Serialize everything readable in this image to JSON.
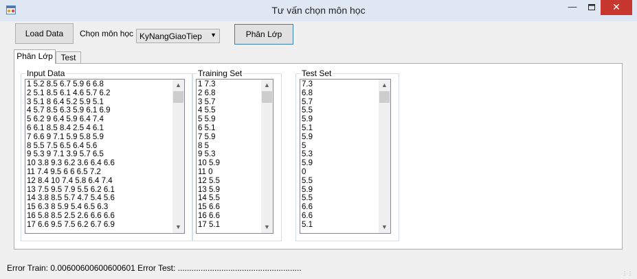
{
  "window": {
    "title": "Tư vấn chọn môn học"
  },
  "toolbar": {
    "load_label": "Load Data",
    "choose_label": "Chọn môn học",
    "combo_value": "KyNangGiaoTiep",
    "classify_label": "Phân Lớp"
  },
  "tabs": [
    {
      "label": "Phân Lớp"
    },
    {
      "label": "Test"
    }
  ],
  "groups": {
    "input": {
      "title": "Input Data",
      "items": [
        "1 5.2 8.5 6.7 5.9 6 6.8",
        "2 5.1 8.5 6.1 4.6 5.7 6.2",
        "3 5.1 8 6.4 5.2 5.9 5.1",
        "4 5.7 8.5 6.3 5.9 6.1 6.9",
        "5 6.2 9 6.4 5.9 6.4 7.4",
        "6 6.1 8.5 8.4 2.5 4 6.1",
        "7 6.6 9 7.1 5.9 5.8 5.9",
        "8 5.5 7.5 6.5 6.4 5.6",
        "9 5.3 9 7.1 3.9 5.7 6.5",
        "10 3.8 9.3 6.2 3.6 6.4 6.6",
        "11 7.4 9.5 6 6 6.5 7.2",
        "12 8.4 10 7.4 5.8 6.4 7.4",
        "13 7.5 9.5 7.9 5.5 6.2 6.1",
        "14 3.8 8.5 5.7 4.7 5.4 5.6",
        "15 6.3 8 5.9 5.4 6.5 6.3",
        "16 5.8 8.5 2.5 2.6 6.6 6.6",
        "17 6.6 9.5 7.5 6.2 6.7 6.9"
      ]
    },
    "training": {
      "title": "Training Set",
      "items": [
        "1 7.3",
        "2 6.8",
        "3 5.7",
        "4 5.5",
        "5 5.9",
        "6 5.1",
        "7 5.9",
        "8 5",
        "9 5.3",
        "10 5.9",
        "11 0",
        "12 5.5",
        "13 5.9",
        "14 5.5",
        "15 6.6",
        "16 6.6",
        "17 5.1"
      ]
    },
    "test": {
      "title": "Test Set",
      "items": [
        "7.3",
        "6.8",
        "5.7",
        "5.5",
        "5.9",
        "5.1",
        "5.9",
        "5",
        "5.3",
        "5.9",
        "0",
        "5.5",
        "5.9",
        "5.5",
        "6.6",
        "6.6",
        "5.1"
      ]
    }
  },
  "status": {
    "error_train_label": "Error Train:",
    "error_train_value": "0.00600600600600601",
    "error_test_label": "Error Test:",
    "error_test_value": "......................................................"
  },
  "icons": {
    "app": "app-window-icon",
    "minimize": "minimize-icon",
    "maximize": "maximize-icon",
    "close": "close-icon",
    "scroll_up": "chevron-up-icon",
    "scroll_down": "chevron-down-icon",
    "combo_arrow": "chevron-down-icon",
    "grip": "resize-grip-icon"
  },
  "colors": {
    "close_button": "#c7372f",
    "titlebar": "#dfe7f2",
    "window_bg": "#f0f0f0"
  }
}
